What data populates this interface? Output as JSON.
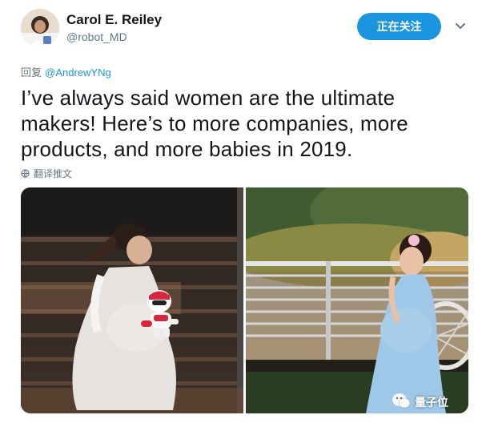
{
  "author": {
    "name": "Carol E. Reiley",
    "handle": "@robot_MD",
    "avatar_icon": "avatar-photo"
  },
  "follow_button": {
    "label": "正在关注",
    "color": "#1b95e0"
  },
  "menu_icon": "chevron-down-icon",
  "reply": {
    "prefix": "回复",
    "mention": "@AndrewYNg"
  },
  "tweet": {
    "line1": "I’ve always said women are the ultimate",
    "line2": "makers! Here’s to more companies, more",
    "line3": "products, and more babies in 2019."
  },
  "translate": {
    "label": "翻译推文",
    "icon": "globe-icon"
  },
  "media": {
    "photos": [
      {
        "subject": "photo-pregnant-woman-with-robot"
      },
      {
        "subject": "photo-pregnant-woman-outdoor"
      }
    ]
  },
  "watermark": {
    "label": "量子位",
    "icon": "wechat-icon"
  }
}
